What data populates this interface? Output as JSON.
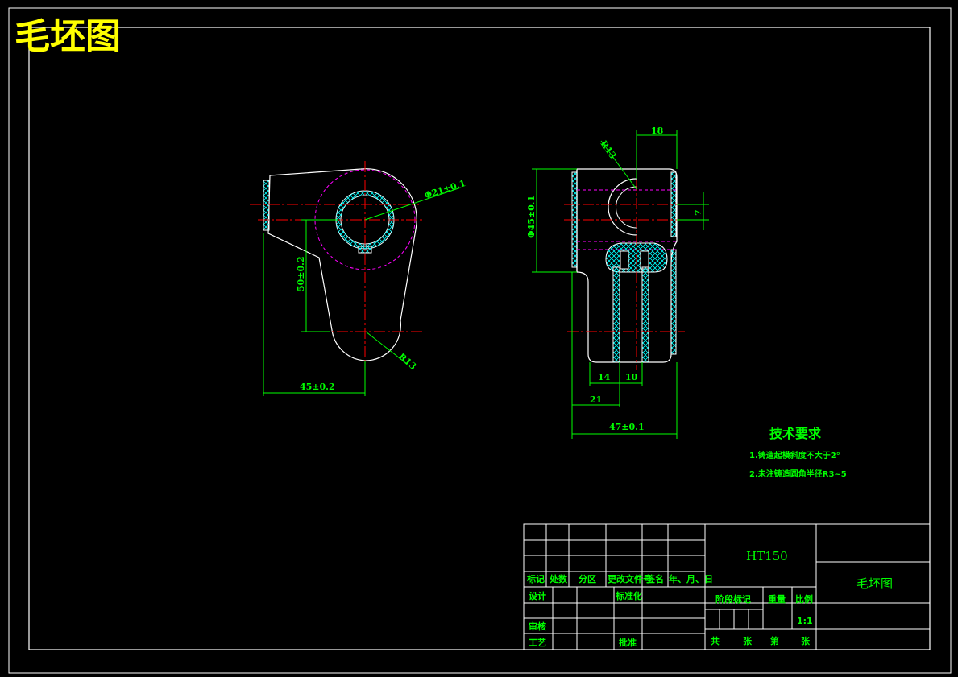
{
  "drawing": {
    "title": "毛坯图",
    "background_color": "#000000",
    "colors": {
      "outline": "#ffffff",
      "center_line": "#ff0000",
      "dimension": "#00ff00",
      "hatch": "#00ffff",
      "hidden": "#ff00ff",
      "title": "#ffff00"
    }
  },
  "views": {
    "left": {
      "dims": {
        "bore": "Φ21±0.1",
        "center_dist": "50±0.2",
        "width": "45±0.2",
        "radius": "R13"
      }
    },
    "right": {
      "dims": {
        "top": "18",
        "radius": "R13",
        "height": "Φ45±0.1",
        "small": "7",
        "d14": "14",
        "d10": "10",
        "d21": "21",
        "width": "47±0.1"
      }
    }
  },
  "notes": {
    "heading": "技术要求",
    "items": [
      "1.铸造起模斜度不大于2°",
      "2.未注铸造圆角半径R3~5"
    ]
  },
  "title_block": {
    "material": "HT150",
    "drawing_name": "毛坯图",
    "header_row": [
      "标记",
      "处数",
      "分区",
      "更改文件号",
      "签名",
      "年、月、日"
    ],
    "design": "设计",
    "standardize": "标准化",
    "stage_mark": "阶段标记",
    "weight": "重量",
    "ratio_label": "比例",
    "ratio_value": "1:1",
    "review": "审核",
    "process": "工艺",
    "approve": "批准",
    "total": "共",
    "sheets": "张",
    "nth": "第",
    "sheet": "张"
  }
}
